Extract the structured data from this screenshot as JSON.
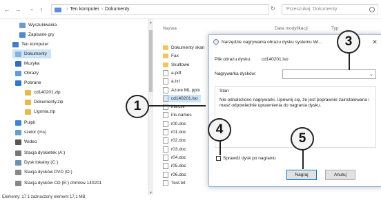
{
  "address": {
    "back": "←",
    "forward": "→",
    "up": "↑",
    "crumbs": [
      "Ten komputer",
      "Dokumenty"
    ],
    "search_placeholder": "Przeszukaj: Dokumenty",
    "refresh": "↻"
  },
  "nav": [
    {
      "label": "Wyszukiwania",
      "icon": "search-icon",
      "color": "#6a9bd1"
    },
    {
      "label": "Zapisane gry",
      "icon": "game-icon",
      "color": "#4a8ccf"
    },
    {
      "label": "Ten komputer",
      "icon": "computer-icon",
      "color": "#3f7fc4"
    },
    {
      "label": "Dokumenty",
      "icon": "documents-icon",
      "color": "#8ab1de",
      "selected": true
    },
    {
      "label": "Muzyka",
      "icon": "music-icon",
      "color": "#2f6fc0"
    },
    {
      "label": "Obrazy",
      "icon": "pictures-icon",
      "color": "#5f9fd6"
    },
    {
      "label": "Pobrane",
      "icon": "download-icon",
      "color": "#2f78c8"
    },
    {
      "label": "cd140201.zip",
      "icon": "zip-icon",
      "color": "#e6b94d"
    },
    {
      "label": "Dokumenty.zip",
      "icon": "zip-icon",
      "color": "#e6b94d"
    },
    {
      "label": "Ligonia.zip",
      "icon": "zip-icon",
      "color": "#e6b94d"
    },
    {
      "label": "Pulpit",
      "icon": "desktop-icon",
      "color": "#3a86d0"
    },
    {
      "label": "szelor (ms)",
      "icon": "user-icon",
      "color": "#6a9bd1"
    },
    {
      "label": "Wideo",
      "icon": "video-icon",
      "color": "#555555"
    },
    {
      "label": "Stacja dyskietek (A:)",
      "icon": "floppy-icon",
      "color": "#777777"
    },
    {
      "label": "Dysk lokalny (C:)",
      "icon": "drive-icon",
      "color": "#6c8fb3"
    },
    {
      "label": "Stacja dysków DVD (D:)",
      "icon": "dvd-icon",
      "color": "#888888"
    },
    {
      "label": "Stacja dysków CD (E:) chmtsw 140201",
      "icon": "cd-icon",
      "color": "#888888"
    }
  ],
  "columns": {
    "name": "Nazwa",
    "modified": "Data modyfikacji",
    "type": "Typ"
  },
  "files": [
    {
      "name": "Dokumenty skan",
      "kind": "folder"
    },
    {
      "name": "Fax",
      "kind": "folder"
    },
    {
      "name": "Skultowe",
      "kind": "folder"
    },
    {
      "name": "a.pdf",
      "kind": "doc"
    },
    {
      "name": "a.txt",
      "kind": "doc"
    },
    {
      "name": "Azure ML.pptx",
      "kind": "doc"
    },
    {
      "name": "cd140201.iso",
      "kind": "iso",
      "selected": true
    },
    {
      "name": "iris.csv",
      "kind": "doc"
    },
    {
      "name": "iris.names",
      "kind": "doc"
    },
    {
      "name": "r00.doc",
      "kind": "doc"
    },
    {
      "name": "r01.doc",
      "kind": "doc"
    },
    {
      "name": "r02.doc",
      "kind": "doc"
    },
    {
      "name": "r03.doc",
      "kind": "doc"
    },
    {
      "name": "r04.doc",
      "kind": "doc"
    },
    {
      "name": "r05.doc",
      "kind": "doc"
    },
    {
      "name": "r06.doc",
      "kind": "doc"
    },
    {
      "name": "Test.txt",
      "kind": "doc"
    }
  ],
  "status": "Elementy: 17    1 zaznaczony element  17,1 MB",
  "dialog": {
    "title": "Narzędzie nagrywania obrazu dysku systemu Wi...",
    "close": "✕",
    "file_label": "Plik obrazu dysku:",
    "file_value": "cd140201.iso",
    "burner_label": "Nagrywarka dysków:",
    "burner_value": "",
    "status_label": "Stan",
    "status_message": "Nie odnaleziono nagrywarki. Upewnij się, że jest poprawnie zainstalowana i masz odpowiednie uprawnienia do nagrania dysku.",
    "verify_label": "Sprawdź dysk po nagraniu",
    "verify_checked": false,
    "burn_button": "Nagraj",
    "cancel_button": "Anuluj"
  },
  "callouts": [
    "1",
    "3",
    "4",
    "5"
  ]
}
